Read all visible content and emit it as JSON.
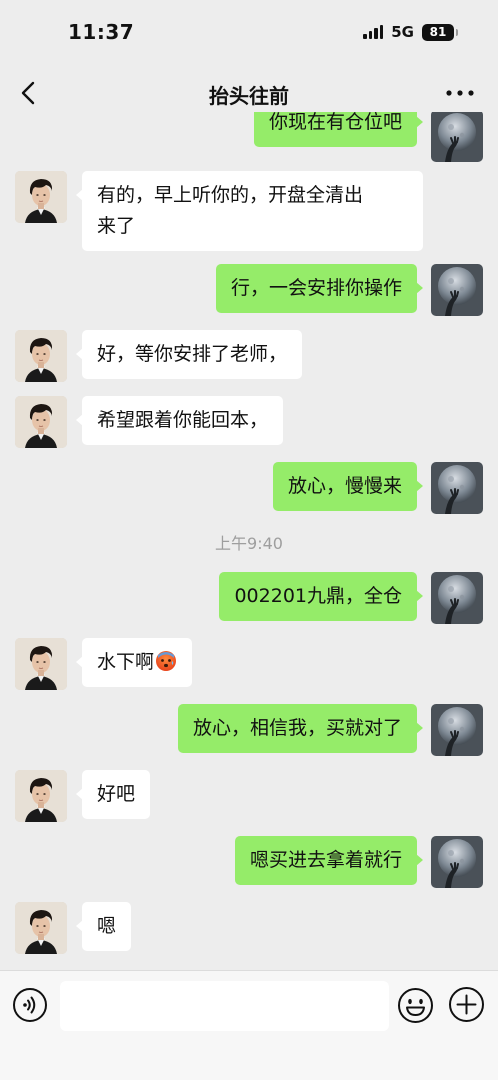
{
  "status_bar": {
    "time": "11:37",
    "network": "5G",
    "battery": "81"
  },
  "nav": {
    "title": "抬头往前",
    "back_icon": "chevron-left-icon",
    "more_icon": "more-dots-icon"
  },
  "messages": [
    {
      "side": "right",
      "text": "你现在有仓位吧"
    },
    {
      "side": "left",
      "text": "有的，早上听你的，开盘全清出\n来了"
    },
    {
      "side": "right",
      "text": "行，一会安排你操作"
    },
    {
      "side": "left",
      "text": "好，等你安排了老师，"
    },
    {
      "side": "left",
      "text": "希望跟着你能回本，"
    },
    {
      "side": "right",
      "text": "放心，慢慢来"
    },
    {
      "side": "timestamp",
      "text": "上午9:40"
    },
    {
      "side": "right",
      "text": "002201九鼎，全仓"
    },
    {
      "side": "left",
      "text": "水下啊",
      "emoji": "cold-sweat-face-emoji"
    },
    {
      "side": "right",
      "text": "放心，相信我，买就对了"
    },
    {
      "side": "left",
      "text": "好吧"
    },
    {
      "side": "right",
      "text": "嗯买进去拿着就行"
    },
    {
      "side": "left",
      "text": "嗯"
    }
  ],
  "input_bar": {
    "voice_icon": "voice-icon",
    "input_value": "",
    "emoji_icon": "smiley-icon",
    "plus_icon": "plus-circle-icon"
  },
  "colors": {
    "background": "#ededed",
    "sent_bubble": "#95ec69",
    "received_bubble": "#ffffff",
    "timestamp_text": "#9e9e9e"
  }
}
